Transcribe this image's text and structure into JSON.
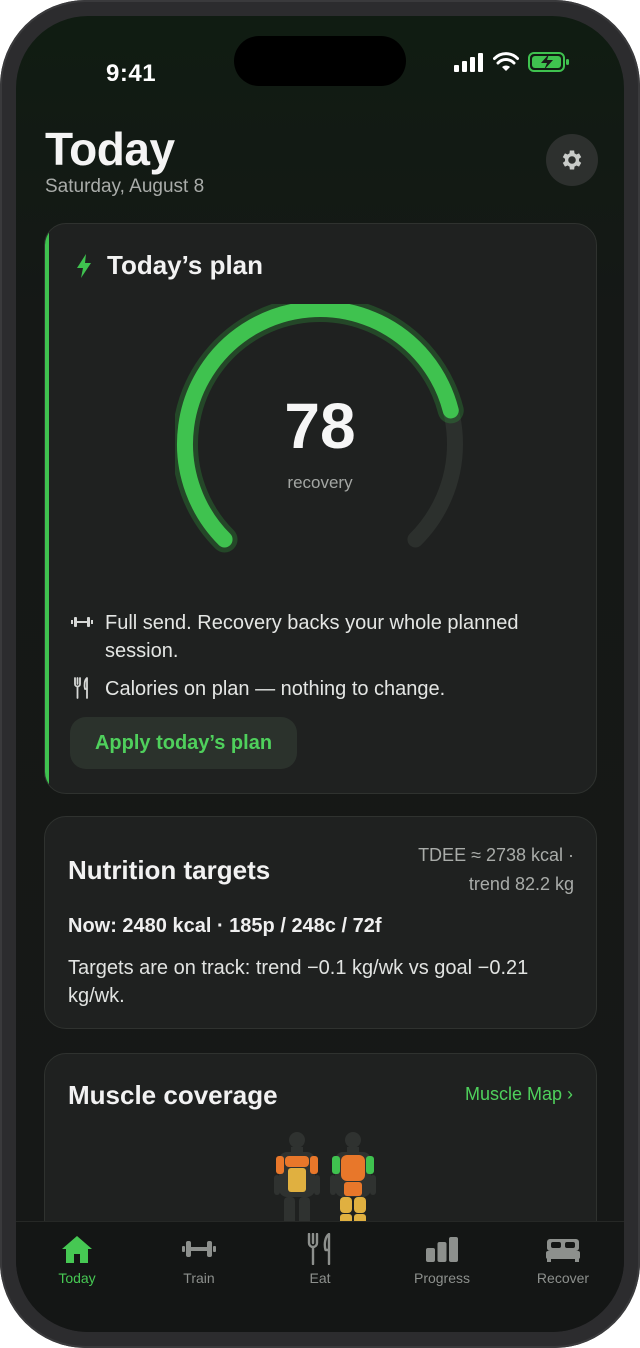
{
  "status_bar": {
    "time": "9:41"
  },
  "header": {
    "title": "Today",
    "date": "Saturday, August 8"
  },
  "plan": {
    "title": "Today’s plan",
    "recovery_score": "78",
    "recovery_label": "recovery",
    "recovery_fraction": 0.78,
    "training_note": "Full send. Recovery backs your whole planned session.",
    "calories_note": "Calories on plan — nothing to change.",
    "apply_label": "Apply today’s plan"
  },
  "nutrition": {
    "title": "Nutrition targets",
    "tdee_line1": "TDEE ≈ 2738 kcal ·",
    "tdee_line2": "trend 82.2 kg",
    "now": "Now: 2480 kcal · 185p / 248c / 72f",
    "status": "Targets are on track: trend −0.1 kg/wk vs goal −0.21 kg/wk."
  },
  "muscle": {
    "title": "Muscle coverage",
    "link": "Muscle Map ›"
  },
  "tabs": [
    {
      "label": "Today",
      "icon": "home-icon",
      "active": true
    },
    {
      "label": "Train",
      "icon": "dumbbell-icon",
      "active": false
    },
    {
      "label": "Eat",
      "icon": "fork-knife-icon",
      "active": false
    },
    {
      "label": "Progress",
      "icon": "bar-chart-icon",
      "active": false
    },
    {
      "label": "Recover",
      "icon": "bed-icon",
      "active": false
    }
  ],
  "colors": {
    "accent": "#3fc24f",
    "background": "#151816",
    "card": "#1f2120"
  }
}
